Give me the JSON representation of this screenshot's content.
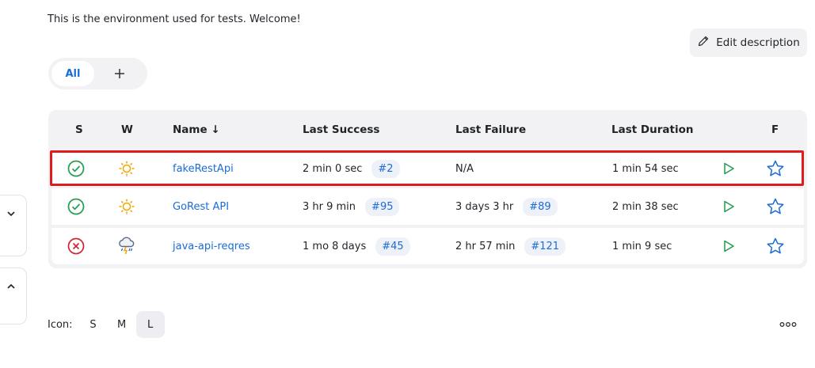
{
  "welcome_text": "This is the environment used for tests. Welcome!",
  "edit_description": {
    "label": "Edit description",
    "icon": "pencil-icon"
  },
  "view_tabs": {
    "all_label": "All",
    "add_icon": "plus-icon"
  },
  "table": {
    "headers": {
      "status": "S",
      "weather": "W",
      "name": "Name ↓",
      "last_success": "Last Success",
      "last_failure": "Last Failure",
      "last_duration": "Last Duration",
      "favorite": "F"
    },
    "rows": [
      {
        "status": "success",
        "weather": "sunny",
        "name": "fakeRestApi",
        "last_success": "2 min 0 sec",
        "last_success_build": "#2",
        "last_failure": "N/A",
        "last_failure_build": "",
        "last_duration": "1 min 54 sec",
        "highlighted": true
      },
      {
        "status": "success",
        "weather": "sunny",
        "name": "GoRest API",
        "last_success": "3 hr 9 min",
        "last_success_build": "#95",
        "last_failure": "3 days 3 hr",
        "last_failure_build": "#89",
        "last_duration": "2 min 38 sec",
        "highlighted": false
      },
      {
        "status": "failure",
        "weather": "stormy",
        "name": "java-api-reqres",
        "last_success": "1 mo 8 days",
        "last_success_build": "#45",
        "last_failure": "2 hr 57 min",
        "last_failure_build": "#121",
        "last_duration": "1 min 9 sec",
        "highlighted": false
      }
    ]
  },
  "icon_size": {
    "label": "Icon:",
    "options": [
      "S",
      "M",
      "L"
    ],
    "selected": "L"
  },
  "colors": {
    "accent": "#1a6cd6",
    "success": "#1e9e4a",
    "failure": "#d1242f",
    "sun": "#f0a500",
    "highlight": "#e01b1b"
  }
}
